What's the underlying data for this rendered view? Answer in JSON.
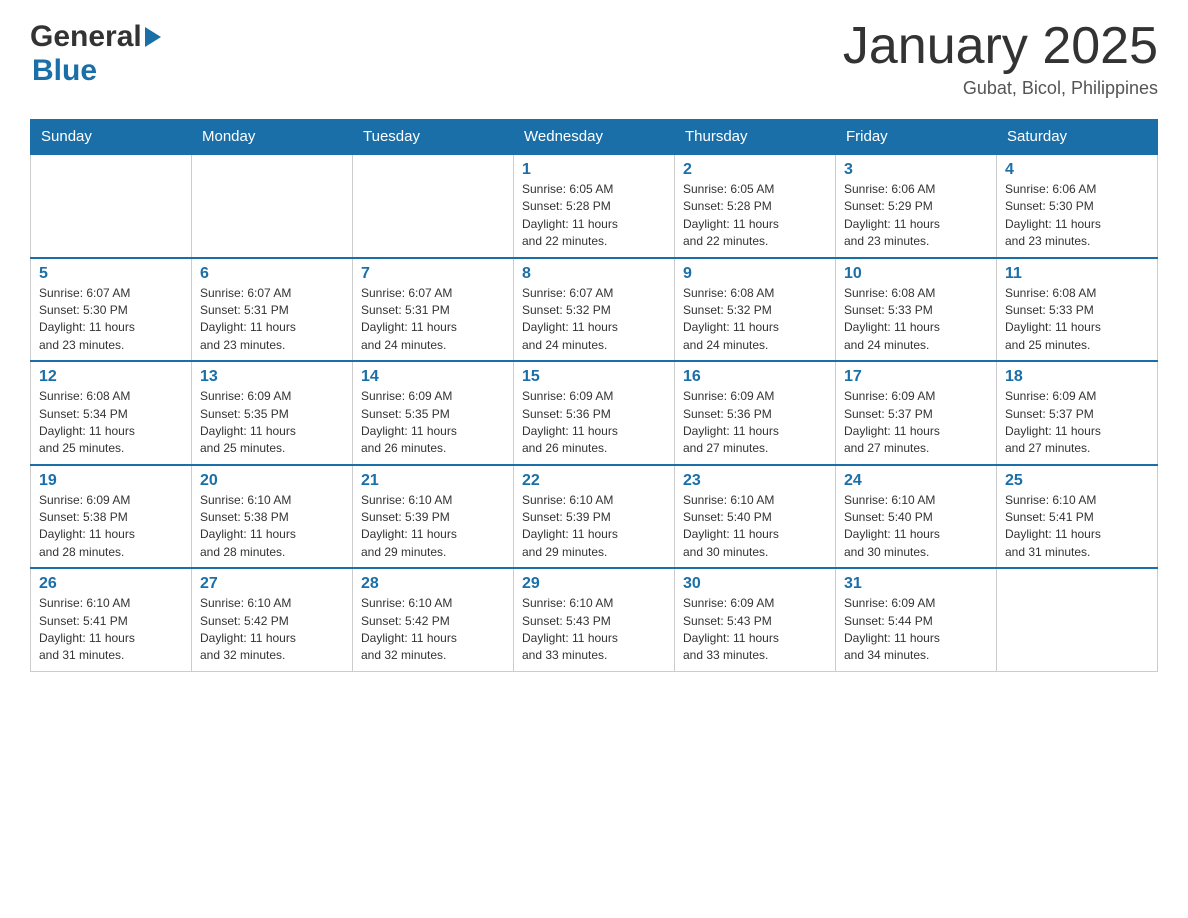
{
  "header": {
    "logo_general": "General",
    "logo_blue": "Blue",
    "title": "January 2025",
    "location": "Gubat, Bicol, Philippines"
  },
  "days_of_week": [
    "Sunday",
    "Monday",
    "Tuesday",
    "Wednesday",
    "Thursday",
    "Friday",
    "Saturday"
  ],
  "weeks": [
    [
      {
        "day": "",
        "info": ""
      },
      {
        "day": "",
        "info": ""
      },
      {
        "day": "",
        "info": ""
      },
      {
        "day": "1",
        "info": "Sunrise: 6:05 AM\nSunset: 5:28 PM\nDaylight: 11 hours\nand 22 minutes."
      },
      {
        "day": "2",
        "info": "Sunrise: 6:05 AM\nSunset: 5:28 PM\nDaylight: 11 hours\nand 22 minutes."
      },
      {
        "day": "3",
        "info": "Sunrise: 6:06 AM\nSunset: 5:29 PM\nDaylight: 11 hours\nand 23 minutes."
      },
      {
        "day": "4",
        "info": "Sunrise: 6:06 AM\nSunset: 5:30 PM\nDaylight: 11 hours\nand 23 minutes."
      }
    ],
    [
      {
        "day": "5",
        "info": "Sunrise: 6:07 AM\nSunset: 5:30 PM\nDaylight: 11 hours\nand 23 minutes."
      },
      {
        "day": "6",
        "info": "Sunrise: 6:07 AM\nSunset: 5:31 PM\nDaylight: 11 hours\nand 23 minutes."
      },
      {
        "day": "7",
        "info": "Sunrise: 6:07 AM\nSunset: 5:31 PM\nDaylight: 11 hours\nand 24 minutes."
      },
      {
        "day": "8",
        "info": "Sunrise: 6:07 AM\nSunset: 5:32 PM\nDaylight: 11 hours\nand 24 minutes."
      },
      {
        "day": "9",
        "info": "Sunrise: 6:08 AM\nSunset: 5:32 PM\nDaylight: 11 hours\nand 24 minutes."
      },
      {
        "day": "10",
        "info": "Sunrise: 6:08 AM\nSunset: 5:33 PM\nDaylight: 11 hours\nand 24 minutes."
      },
      {
        "day": "11",
        "info": "Sunrise: 6:08 AM\nSunset: 5:33 PM\nDaylight: 11 hours\nand 25 minutes."
      }
    ],
    [
      {
        "day": "12",
        "info": "Sunrise: 6:08 AM\nSunset: 5:34 PM\nDaylight: 11 hours\nand 25 minutes."
      },
      {
        "day": "13",
        "info": "Sunrise: 6:09 AM\nSunset: 5:35 PM\nDaylight: 11 hours\nand 25 minutes."
      },
      {
        "day": "14",
        "info": "Sunrise: 6:09 AM\nSunset: 5:35 PM\nDaylight: 11 hours\nand 26 minutes."
      },
      {
        "day": "15",
        "info": "Sunrise: 6:09 AM\nSunset: 5:36 PM\nDaylight: 11 hours\nand 26 minutes."
      },
      {
        "day": "16",
        "info": "Sunrise: 6:09 AM\nSunset: 5:36 PM\nDaylight: 11 hours\nand 27 minutes."
      },
      {
        "day": "17",
        "info": "Sunrise: 6:09 AM\nSunset: 5:37 PM\nDaylight: 11 hours\nand 27 minutes."
      },
      {
        "day": "18",
        "info": "Sunrise: 6:09 AM\nSunset: 5:37 PM\nDaylight: 11 hours\nand 27 minutes."
      }
    ],
    [
      {
        "day": "19",
        "info": "Sunrise: 6:09 AM\nSunset: 5:38 PM\nDaylight: 11 hours\nand 28 minutes."
      },
      {
        "day": "20",
        "info": "Sunrise: 6:10 AM\nSunset: 5:38 PM\nDaylight: 11 hours\nand 28 minutes."
      },
      {
        "day": "21",
        "info": "Sunrise: 6:10 AM\nSunset: 5:39 PM\nDaylight: 11 hours\nand 29 minutes."
      },
      {
        "day": "22",
        "info": "Sunrise: 6:10 AM\nSunset: 5:39 PM\nDaylight: 11 hours\nand 29 minutes."
      },
      {
        "day": "23",
        "info": "Sunrise: 6:10 AM\nSunset: 5:40 PM\nDaylight: 11 hours\nand 30 minutes."
      },
      {
        "day": "24",
        "info": "Sunrise: 6:10 AM\nSunset: 5:40 PM\nDaylight: 11 hours\nand 30 minutes."
      },
      {
        "day": "25",
        "info": "Sunrise: 6:10 AM\nSunset: 5:41 PM\nDaylight: 11 hours\nand 31 minutes."
      }
    ],
    [
      {
        "day": "26",
        "info": "Sunrise: 6:10 AM\nSunset: 5:41 PM\nDaylight: 11 hours\nand 31 minutes."
      },
      {
        "day": "27",
        "info": "Sunrise: 6:10 AM\nSunset: 5:42 PM\nDaylight: 11 hours\nand 32 minutes."
      },
      {
        "day": "28",
        "info": "Sunrise: 6:10 AM\nSunset: 5:42 PM\nDaylight: 11 hours\nand 32 minutes."
      },
      {
        "day": "29",
        "info": "Sunrise: 6:10 AM\nSunset: 5:43 PM\nDaylight: 11 hours\nand 33 minutes."
      },
      {
        "day": "30",
        "info": "Sunrise: 6:09 AM\nSunset: 5:43 PM\nDaylight: 11 hours\nand 33 minutes."
      },
      {
        "day": "31",
        "info": "Sunrise: 6:09 AM\nSunset: 5:44 PM\nDaylight: 11 hours\nand 34 minutes."
      },
      {
        "day": "",
        "info": ""
      }
    ]
  ]
}
